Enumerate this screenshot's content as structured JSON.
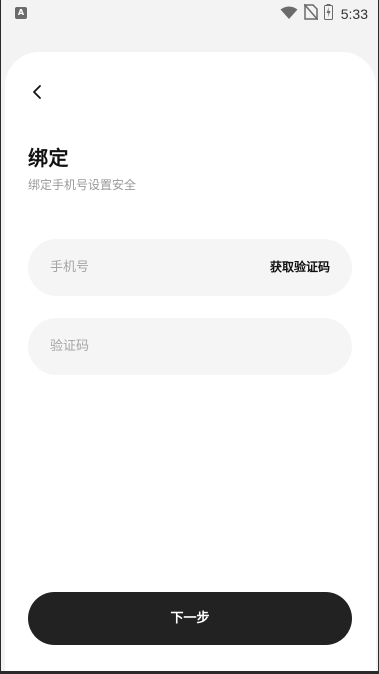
{
  "status_bar": {
    "left_icon_letter": "A",
    "time": "5:33",
    "icons": [
      "wifi-icon",
      "no-sim-icon",
      "battery-charging-icon"
    ]
  },
  "header": {
    "back_icon": "chevron-left-icon",
    "title": "绑定",
    "subtitle": "绑定手机号设置安全"
  },
  "form": {
    "phone": {
      "placeholder": "手机号",
      "value": "",
      "get_code_label": "获取验证码"
    },
    "code": {
      "placeholder": "验证码",
      "value": ""
    }
  },
  "actions": {
    "next_label": "下一步"
  }
}
